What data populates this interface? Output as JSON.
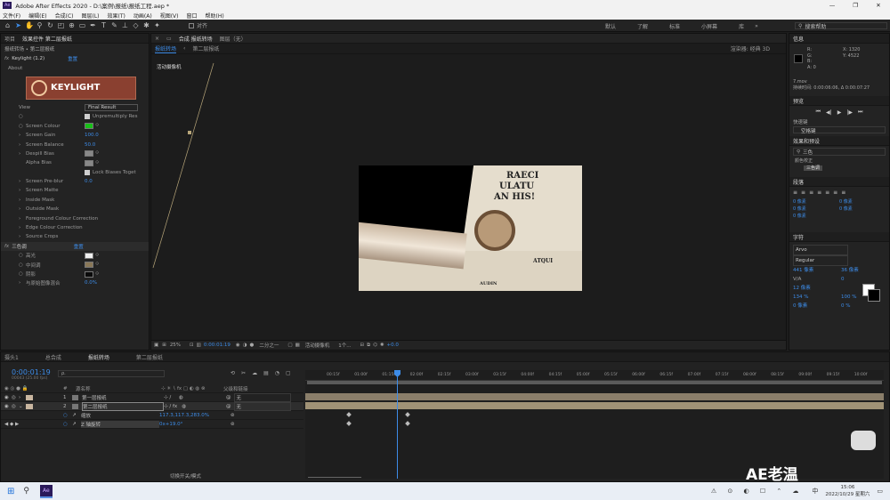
{
  "window": {
    "app_icon": "Ae",
    "title": "Adobe After Effects 2020 - D:\\案例\\报纸\\报纸工程.aep *",
    "controls": [
      "—",
      "❐",
      "✕"
    ]
  },
  "menu": [
    "文件(F)",
    "编辑(E)",
    "合成(C)",
    "图层(L)",
    "效果(T)",
    "动画(A)",
    "视图(V)",
    "窗口",
    "帮助(H)"
  ],
  "toolbar": {
    "snap_label": "对齐",
    "workspaces": [
      "默认",
      "了解",
      "标准",
      "小屏幕",
      "库"
    ],
    "search_placeholder": "搜索帮助"
  },
  "left_panel": {
    "tabs": [
      "项目",
      "效果控件 第二层报纸"
    ],
    "breadcrumb": "报纸转场 • 第二层报纸",
    "keylight": {
      "name": "Keylight (1.2)",
      "reset": "重置",
      "about": "About",
      "logo_text": "KEYLIGHT"
    },
    "rows": [
      {
        "label": "View",
        "value": "Final Result"
      },
      {
        "label": "",
        "value": "Unpremultiply Res"
      },
      {
        "label": "Screen Colour",
        "value": ""
      },
      {
        "label": "Screen Gain",
        "value": "100.0"
      },
      {
        "label": "Screen Balance",
        "value": "50.0"
      },
      {
        "label": "Despill Bias",
        "value": ""
      },
      {
        "label": "Alpha Bias",
        "value": ""
      },
      {
        "label": "",
        "value": "Lock Biases Toget"
      },
      {
        "label": "Screen Pre-blur",
        "value": "0.0"
      },
      {
        "label": "Screen Matte",
        "value": ""
      },
      {
        "label": "Inside Mask",
        "value": ""
      },
      {
        "label": "Outside Mask",
        "value": ""
      },
      {
        "label": "Foreground Colour Correction",
        "value": ""
      },
      {
        "label": "Edge Colour Correction",
        "value": ""
      },
      {
        "label": "Source Crops",
        "value": ""
      }
    ],
    "tritone": {
      "name": "三色调",
      "reset": "重置",
      "rows": [
        {
          "label": "高光",
          "value": ""
        },
        {
          "label": "中间调",
          "value": ""
        },
        {
          "label": "阴影",
          "value": ""
        },
        {
          "label": "与原始图像混合",
          "value": "0.0%"
        }
      ]
    },
    "colors": {
      "screen": "#18c018",
      "highlight": "#efefef",
      "midtone": "#8a7858",
      "shadow": "#0a0a0a",
      "keylight_bg": "#8a4030"
    }
  },
  "comp": {
    "tabs": [
      "合成 报纸转场",
      "图层（无）"
    ],
    "subtabs": [
      "报纸转场",
      "第二层报纸"
    ],
    "renderer": "渲染器: 经典 3D",
    "camera_label": "活动摄像机",
    "zoom": "25%",
    "timecode": "0:00:01:19",
    "resolution": "二分之一",
    "view": "活动摄像机",
    "views": "1个...",
    "exposure": "+0.0",
    "newspaper_text": [
      "RAECI",
      "ULATU",
      "AN HIS!",
      "ATQUI",
      "AUDIN"
    ]
  },
  "right_panel": {
    "info_tab": "信息",
    "info": [
      "R:",
      "G:",
      "B:",
      "A: 0",
      "X: 1320",
      "Y: 4522"
    ],
    "info_extra": [
      "7.mov",
      "持续时间: 0:00:06:06, Δ 0:00:07:27"
    ],
    "preview_tab": "预览",
    "preset_tab": "快速键",
    "preset_value": "空格键",
    "effects_tab": "效果和预设",
    "effects_search": "三色",
    "effects_tree": [
      "颜色校正",
      "三色调"
    ],
    "paragraph_tab": "段落",
    "para_values": [
      "0 像素",
      "0 像素",
      "0 像素",
      "0 像素",
      "0 像素"
    ],
    "character_tab": "字符",
    "font": "Arvo",
    "style": "Regular",
    "size": "441 像素",
    "leading": "36 像素",
    "tracking": "0",
    "stroke": "12 像素",
    "vscale": "134 %",
    "hscale": "100 %",
    "baseline": "0 像素",
    "tsume": "0 %"
  },
  "timeline": {
    "tabs": [
      "摄头1",
      "总合成",
      "报纸转场",
      "第二层报纸"
    ],
    "timecode": "0:00:01:19",
    "fps": "00043 (25.00 fps)",
    "search_placeholder": "ρ.",
    "header": [
      "源名称",
      "父级和链接"
    ],
    "layers": [
      {
        "num": "1",
        "name": "第一层报纸",
        "parent": "无"
      },
      {
        "num": "2",
        "name": "第二层报纸",
        "parent": "无"
      }
    ],
    "props": [
      {
        "name": "缩放",
        "value": "117.3,117.3,283.0%"
      },
      {
        "name": "Z 轴旋转",
        "value": "0x+19.0°"
      }
    ],
    "ruler": [
      "00:15f",
      "01:00f",
      "01:15f",
      "02:00f",
      "02:15f",
      "03:00f",
      "03:15f",
      "04:00f",
      "04:15f",
      "05:00f",
      "05:15f",
      "06:00f",
      "06:15f",
      "07:00f",
      "07:15f",
      "08:00f",
      "08:15f",
      "09:00f",
      "09:15f",
      "10:00f"
    ],
    "footer": "切换开关/模式"
  },
  "watermark": "AE老温",
  "taskbar": {
    "time": "15:06",
    "date": "2022/10/29 星期六",
    "ime": "中",
    "app": "Ae"
  }
}
